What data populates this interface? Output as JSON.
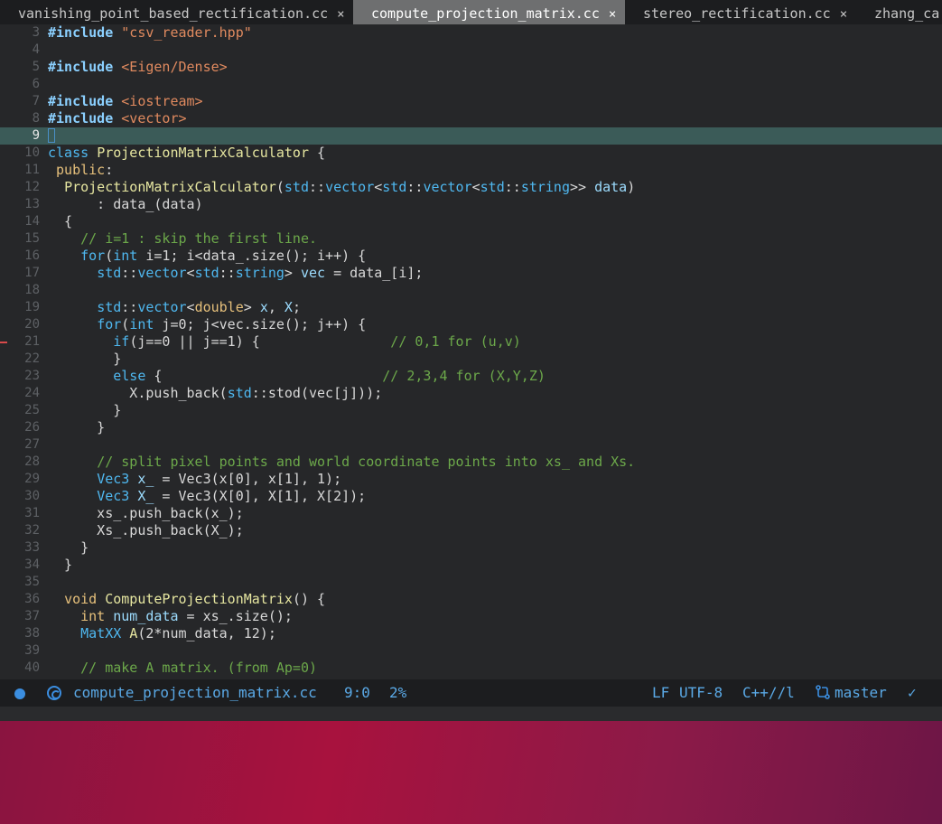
{
  "tabs": [
    {
      "label": "vanishing_point_based_rectification.cc",
      "close": "×",
      "active": false
    },
    {
      "label": "compute_projection_matrix.cc",
      "close": "×",
      "active": true
    },
    {
      "label": "stereo_rectification.cc",
      "close": "×",
      "active": false
    },
    {
      "label": "zhang_ca",
      "close": "",
      "active": false
    }
  ],
  "editor": {
    "line_numbers": [
      "3",
      "4",
      "5",
      "6",
      "7",
      "8",
      "9",
      "10",
      "11",
      "12",
      "13",
      "14",
      "15",
      "16",
      "17",
      "18",
      "19",
      "20",
      "21",
      "22",
      "23",
      "24",
      "25",
      "26",
      "27",
      "28",
      "29",
      "30",
      "31",
      "32",
      "33",
      "34",
      "35",
      "36",
      "37",
      "38",
      "39",
      "40"
    ],
    "current_line": "9"
  },
  "status": {
    "file_name": "compute_projection_matrix.cc",
    "cursor_pos": "9:0",
    "scroll_percent": "2%",
    "line_ending": "LF",
    "encoding": "UTF-8",
    "grammar": "C++//l",
    "branch": "master",
    "branch_icon": "git-branch-icon",
    "check": "✓"
  },
  "colors": {
    "accent": "#3b8ee0",
    "current_line_bg": "#3b5b58",
    "desktop": "#a8123e"
  }
}
